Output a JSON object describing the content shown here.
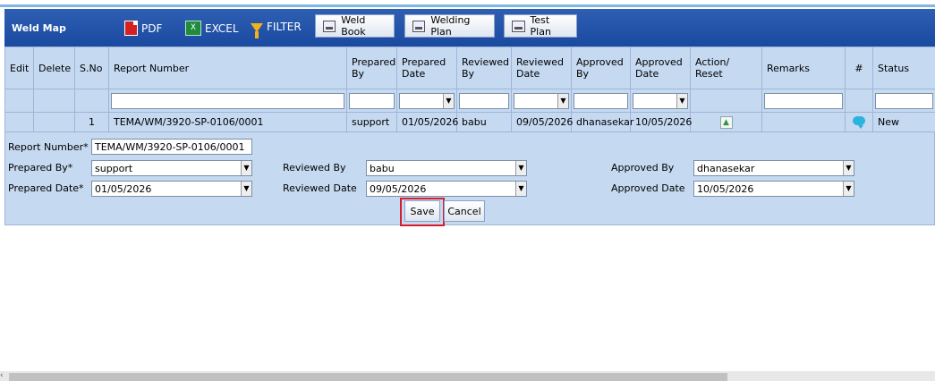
{
  "toolbar": {
    "title": "Weld Map",
    "pdf_label": "PDF",
    "excel_label": "EXCEL",
    "filter_label": "FILTER",
    "weld_book_label": "Weld Book",
    "welding_plan_label": "Welding Plan",
    "test_plan_label": "Test Plan",
    "bg_color": "#1a4aa0"
  },
  "grid": {
    "headers": {
      "edit": "Edit",
      "delete": "Delete",
      "sno": "S.No",
      "report_number": "Report Number",
      "prepared_by": "Prepared By",
      "prepared_date": "Prepared Date",
      "reviewed_by": "Reviewed By",
      "reviewed_date": "Reviewed Date",
      "approved_by": "Approved By",
      "approved_date": "Approved Date",
      "action_reset": "Action/ Reset",
      "remarks": "Remarks",
      "hash": "#",
      "status": "Status"
    },
    "rows": [
      {
        "sno": "1",
        "report_number": "TEMA/WM/3920-SP-0106/0001",
        "prepared_by": "support",
        "prepared_date": "01/05/2026",
        "reviewed_by": "babu",
        "reviewed_date": "09/05/2026",
        "approved_by": "dhanasekar",
        "approved_date": "10/05/2026",
        "status": "New"
      }
    ]
  },
  "form": {
    "report_number_label": "Report Number*",
    "report_number_value": "TEMA/WM/3920-SP-0106/0001",
    "prepared_by_label": "Prepared By*",
    "prepared_by_value": "support",
    "prepared_date_label": "Prepared Date*",
    "prepared_date_value": "01/05/2026",
    "reviewed_by_label": "Reviewed By",
    "reviewed_by_value": "babu",
    "reviewed_date_label": "Reviewed Date",
    "reviewed_date_value": "09/05/2026",
    "approved_by_label": "Approved By",
    "approved_by_value": "dhanasekar",
    "approved_date_label": "Approved Date",
    "approved_date_value": "10/05/2026",
    "save_label": "Save",
    "cancel_label": "Cancel",
    "highlight_color": "#d61f2e"
  }
}
